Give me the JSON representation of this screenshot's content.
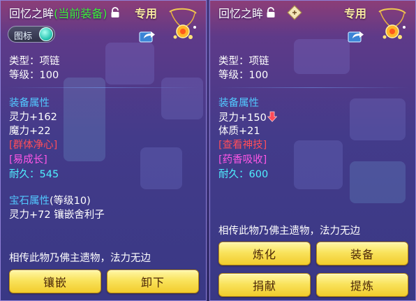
{
  "left": {
    "title": "回忆之眸",
    "equipped_tag": "(当前装备)",
    "special": "专用",
    "toggle_label": "图标",
    "type_line": "类型：项链",
    "level_line": "等级：100",
    "attr_header": "装备属性",
    "stats": [
      "灵力+162",
      "魔力+22"
    ],
    "skill_red": "[群体净心]",
    "skill_magenta": "[易成长]",
    "durability": "耐久：545",
    "gem_header": "宝石属性",
    "gem_level": "(等级10)",
    "gem_line": "灵力+72 镶嵌舍利子",
    "description": "相传此物乃佛主遗物，法力无边",
    "buttons": [
      "镶嵌",
      "卸下"
    ]
  },
  "right": {
    "title": "回忆之眸",
    "special": "专用",
    "type_line": "类型：项链",
    "level_line": "等级：100",
    "attr_header": "装备属性",
    "stat_compare": "灵力+150",
    "stat2": "体质+21",
    "skill_red": "[查看神技]",
    "skill_magenta": "[药香吸收]",
    "durability": "耐久：600",
    "description": "相传此物乃佛主遗物，法力无边",
    "buttons": [
      "炼化",
      "装备",
      "捐献",
      "提炼"
    ]
  },
  "icons": {
    "lock": "lock-icon",
    "share": "share-icon",
    "down_arrow": "down-arrow-icon",
    "diamond": "diamond-tag-icon",
    "amulet": "necklace-item-icon"
  },
  "colors": {
    "title_green": "#3ff23a",
    "header_blue": "#52c8ff",
    "durability_cyan": "#4ff0ff",
    "skill_red": "#ff4d5a",
    "skill_magenta": "#ff56e6",
    "button_yellow": "#f9e35d"
  }
}
